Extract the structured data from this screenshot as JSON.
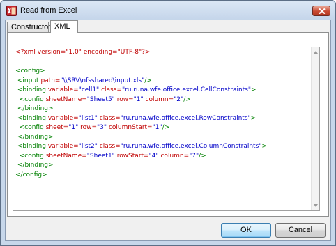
{
  "window": {
    "title": "Read from Excel"
  },
  "tabs": [
    {
      "label": "Constructor",
      "active": false
    },
    {
      "label": "XML",
      "active": true
    }
  ],
  "editor": {
    "lines": [
      [
        {
          "t": "decl",
          "s": "<?xml version=\"1.0\" encoding=\"UTF-8\"?>"
        }
      ],
      [],
      [
        {
          "t": "tag",
          "s": "<config>"
        }
      ],
      [
        {
          "t": "text",
          "s": " "
        },
        {
          "t": "tag",
          "s": "<input "
        },
        {
          "t": "attr",
          "s": "path="
        },
        {
          "t": "val",
          "s": "\"\\\\SRV\\nfsshared\\input.xls\""
        },
        {
          "t": "tag",
          "s": "/>"
        }
      ],
      [
        {
          "t": "text",
          "s": " "
        },
        {
          "t": "tag",
          "s": "<binding "
        },
        {
          "t": "attr",
          "s": "variable="
        },
        {
          "t": "val",
          "s": "\"cell1\""
        },
        {
          "t": "text",
          "s": " "
        },
        {
          "t": "attr",
          "s": "class="
        },
        {
          "t": "val",
          "s": "\"ru.runa.wfe.office.excel.CellConstraints\""
        },
        {
          "t": "tag",
          "s": ">"
        }
      ],
      [
        {
          "t": "text",
          "s": "  "
        },
        {
          "t": "tag",
          "s": "<config "
        },
        {
          "t": "attr",
          "s": "sheetName="
        },
        {
          "t": "val",
          "s": "\"Sheet5\""
        },
        {
          "t": "text",
          "s": " "
        },
        {
          "t": "attr",
          "s": "row="
        },
        {
          "t": "val",
          "s": "\"1\""
        },
        {
          "t": "text",
          "s": " "
        },
        {
          "t": "attr",
          "s": "column="
        },
        {
          "t": "val",
          "s": "\"2\""
        },
        {
          "t": "tag",
          "s": "/>"
        }
      ],
      [
        {
          "t": "text",
          "s": " "
        },
        {
          "t": "tag",
          "s": "</binding>"
        }
      ],
      [
        {
          "t": "text",
          "s": " "
        },
        {
          "t": "tag",
          "s": "<binding "
        },
        {
          "t": "attr",
          "s": "variable="
        },
        {
          "t": "val",
          "s": "\"list1\""
        },
        {
          "t": "text",
          "s": " "
        },
        {
          "t": "attr",
          "s": "class="
        },
        {
          "t": "val",
          "s": "\"ru.runa.wfe.office.excel.RowConstraints\""
        },
        {
          "t": "tag",
          "s": ">"
        }
      ],
      [
        {
          "t": "text",
          "s": "  "
        },
        {
          "t": "tag",
          "s": "<config "
        },
        {
          "t": "attr",
          "s": "sheet="
        },
        {
          "t": "val",
          "s": "\"1\""
        },
        {
          "t": "text",
          "s": " "
        },
        {
          "t": "attr",
          "s": "row="
        },
        {
          "t": "val",
          "s": "\"3\""
        },
        {
          "t": "text",
          "s": " "
        },
        {
          "t": "attr",
          "s": "columnStart="
        },
        {
          "t": "val",
          "s": "\"1\""
        },
        {
          "t": "tag",
          "s": "/>"
        }
      ],
      [
        {
          "t": "text",
          "s": " "
        },
        {
          "t": "tag",
          "s": "</binding>"
        }
      ],
      [
        {
          "t": "text",
          "s": " "
        },
        {
          "t": "tag",
          "s": "<binding "
        },
        {
          "t": "attr",
          "s": "variable="
        },
        {
          "t": "val",
          "s": "\"list2\""
        },
        {
          "t": "text",
          "s": " "
        },
        {
          "t": "attr",
          "s": "class="
        },
        {
          "t": "val",
          "s": "\"ru.runa.wfe.office.excel.ColumnConstraints\""
        },
        {
          "t": "tag",
          "s": ">"
        }
      ],
      [
        {
          "t": "text",
          "s": "  "
        },
        {
          "t": "tag",
          "s": "<config "
        },
        {
          "t": "attr",
          "s": "sheetName="
        },
        {
          "t": "val",
          "s": "\"Sheet1\""
        },
        {
          "t": "text",
          "s": " "
        },
        {
          "t": "attr",
          "s": "rowStart="
        },
        {
          "t": "val",
          "s": "\"4\""
        },
        {
          "t": "text",
          "s": " "
        },
        {
          "t": "attr",
          "s": "column="
        },
        {
          "t": "val",
          "s": "\"7\""
        },
        {
          "t": "tag",
          "s": "/>"
        }
      ],
      [
        {
          "t": "text",
          "s": " "
        },
        {
          "t": "tag",
          "s": "</binding>"
        }
      ],
      [
        {
          "t": "tag",
          "s": "</config>"
        }
      ]
    ]
  },
  "buttons": {
    "ok": "OK",
    "cancel": "Cancel"
  },
  "icons": {
    "app": "excel-icon",
    "close": "close-icon"
  },
  "colors": {
    "tag": "#008000",
    "attr": "#c00000",
    "value": "#0000c8"
  }
}
